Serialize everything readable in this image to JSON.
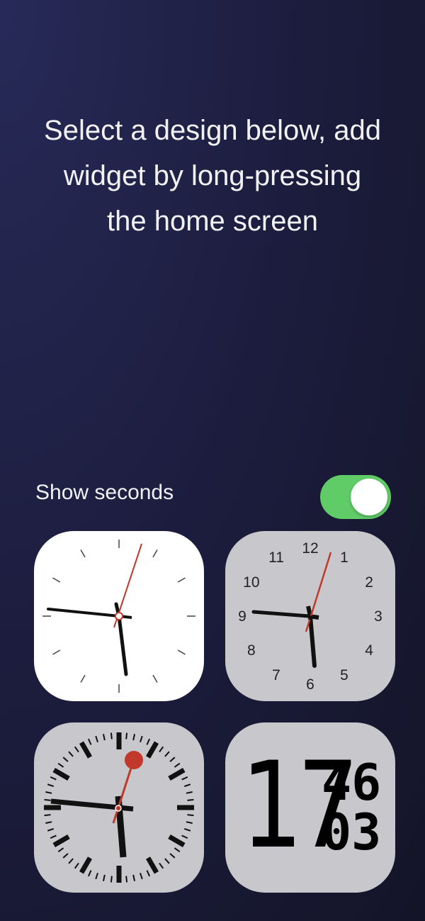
{
  "instruction": {
    "line1": "Select a design below, add",
    "line2": "widget by long-pressing",
    "line3": "the home screen"
  },
  "settings": {
    "show_seconds_label": "Show seconds",
    "show_seconds_enabled": true,
    "toggle_color": "#5fcc68"
  },
  "widgets": {
    "numeric_dial_labels": [
      "12",
      "1",
      "2",
      "3",
      "4",
      "5",
      "6",
      "7",
      "8",
      "9",
      "10",
      "11"
    ],
    "digital": {
      "hour": "17",
      "minute": "46",
      "second": "03"
    }
  },
  "colors": {
    "second_hand": "#c0392b",
    "tile_light": "#ffffff",
    "tile_gray": "#c8c8cc"
  }
}
